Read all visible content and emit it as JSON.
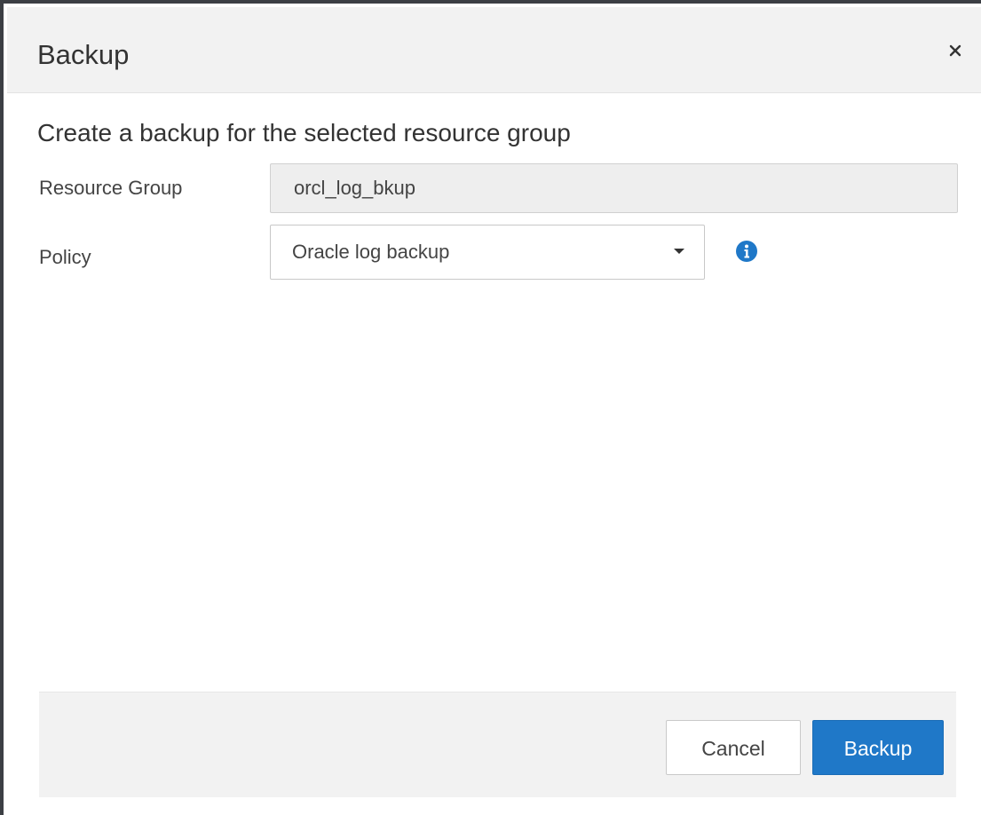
{
  "dialog": {
    "title": "Backup",
    "close_label": "×",
    "subtitle": "Create a backup for the selected resource group"
  },
  "form": {
    "resource_group_label": "Resource Group",
    "resource_group_value": "orcl_log_bkup",
    "policy_label": "Policy",
    "policy_value": "Oracle log backup"
  },
  "footer": {
    "cancel_label": "Cancel",
    "backup_label": "Backup"
  },
  "colors": {
    "primary": "#1f78c8",
    "info_icon": "#1f78c8",
    "header_bg": "#f2f2f2"
  },
  "icons": {
    "close": "close-icon",
    "dropdown": "chevron-down-icon",
    "info": "info-icon"
  }
}
